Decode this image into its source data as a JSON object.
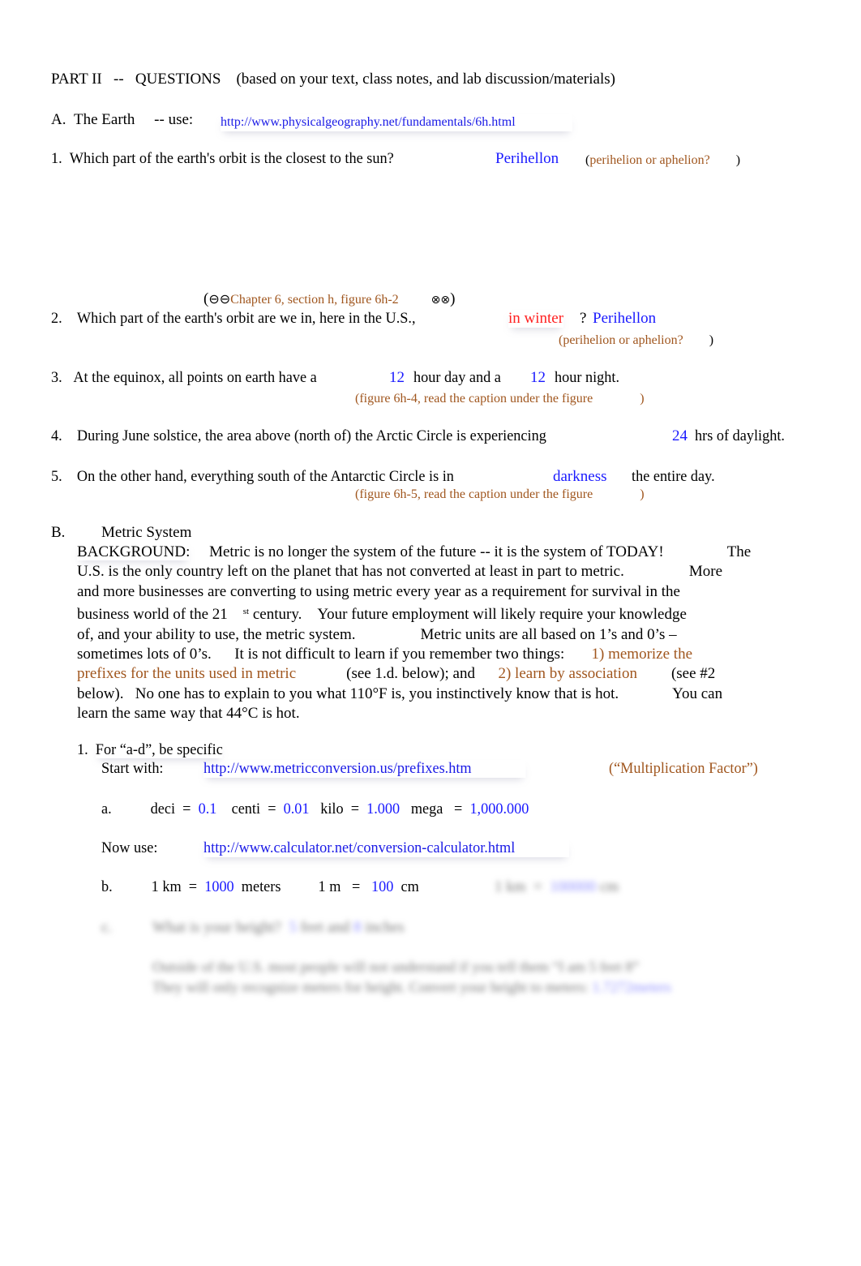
{
  "header": {
    "title": "PART II",
    "dash": "--",
    "questions": "QUESTIONS",
    "subtitle": "(based on your text, class notes, and lab discussion/materials)"
  },
  "section_a": {
    "label": "A.",
    "title": "The Earth",
    "use_text": "--  use:",
    "link": "http://www.physicalgeography.net/fundamentals/6h.html",
    "q1": {
      "num": "1.",
      "text": "Which part of the earth's orbit is the closest to the sun?",
      "answer": "Perihellon",
      "hint_open": "(",
      "hint": "perihelion or aphelion?",
      "hint_close": ")"
    },
    "ref": {
      "open": "(",
      "icons_left": "⊖⊖",
      "text": "Chapter 6, section h, figure 6h-2",
      "icons_right": "⊗⊗",
      "close": ")"
    },
    "q2": {
      "num": "2.",
      "text": "Which part of the earth's orbit are we in, here in the U.S.,",
      "emphasis": "in winter",
      "qmark": "?",
      "answer": "Perihellon",
      "hint": "(perihelion or aphelion?",
      "hint_close": ")"
    },
    "q3": {
      "num": "3.",
      "text1": "At the equinox, all points on earth have a",
      "answer1": "12",
      "text2": "hour day and a",
      "answer2": "12",
      "text3": "hour night.",
      "hint": "(figure 6h-4, read the caption under the figure",
      "hint_close": ")"
    },
    "q4": {
      "num": "4.",
      "text1": "During June solstice, the area above (north of) the Arctic Circle is experiencing",
      "answer": "24",
      "text2": "hrs of daylight."
    },
    "q5": {
      "num": "5.",
      "text1": "On the other hand, everything south of the Antarctic Circle is in",
      "answer": "darkness",
      "text2": "the entire day.",
      "hint": "(figure 6h-5, read the caption under the figure",
      "hint_close": ")"
    }
  },
  "section_b": {
    "label": "B.",
    "title": "Metric System",
    "background": {
      "lines": [
        [
          "BACKGROUND:",
          "Metric is no longer the system of the future -- it is the system of TODAY!",
          "The"
        ],
        [
          "U.S. is the only country left on the planet that has not converted at least in part to metric.",
          "More"
        ],
        [
          "and more businesses are converting to using metric every year as a requirement for survival in the"
        ],
        [
          "business world of the 21",
          "st",
          "century.",
          "Your future employment will likely require your knowledge"
        ],
        [
          "of, and your ability to use, the metric system.",
          "Metric units are all based on 1’s and 0’s –"
        ],
        [
          "sometimes lots of 0’s.",
          "It is not difficult to learn if you remember two things:",
          "1) memorize the"
        ],
        [
          "prefixes for the units used in metric",
          "(see 1.d. below); and",
          "2) learn by association",
          "(see #2"
        ],
        [
          "below).",
          "No one has to explain to you what 110°F is, you instinctively know that is hot.",
          "You can"
        ],
        [
          "learn the same way that 44°C is hot."
        ]
      ]
    },
    "item1": {
      "num": "1.",
      "text": "For  “a-d”,  be  specific",
      "start_with": "Start with:",
      "link": "http://www.metricconversion.us/prefixes.htm",
      "note": "(“Multiplication Factor”)"
    },
    "a": {
      "label": "a.",
      "deci": "deci",
      "deci_val": "0.1",
      "centi": "centi",
      "centi_val": "0.01",
      "kilo": "kilo",
      "kilo_val": "1.000",
      "mega": "mega",
      "mega_val": "1,000.000",
      "eq": "="
    },
    "now_use": {
      "label": "Now use:",
      "link": "http://www.calculator.net/conversion-calculator.html"
    },
    "b": {
      "label": "b.",
      "km": "1 km",
      "km_val": "1000",
      "km_unit": "meters",
      "m": "1 m",
      "m_val": "100",
      "m_unit": "cm",
      "blur_left": "1 km",
      "blur_eq": "=",
      "blur_val": "100000",
      "blur_unit": "cm",
      "eq": "="
    },
    "c": {
      "label": "c.",
      "q": "What is your height?",
      "feet": "5",
      "feet_text": "feet and",
      "inches": "8",
      "inches_text": "inches",
      "line1": "Outside of the U.S. most people will not understand if you tell them “I am 5 feet 8”",
      "line2": "They will only recognize meters for height.  Convert your height to meters:",
      "answer": "1.7272meters"
    }
  }
}
